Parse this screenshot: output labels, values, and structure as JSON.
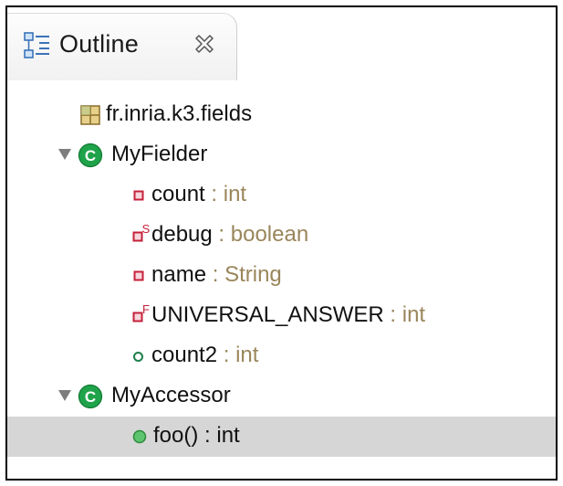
{
  "tab": {
    "title": "Outline",
    "icon": "outline-icon",
    "close_icon": "close-icon"
  },
  "tree": [
    {
      "id": "package",
      "name": "fr.inria.k3.fields",
      "type": "",
      "icon": "package-icon",
      "expanded": null
    },
    {
      "id": "class-myfielder",
      "name": "MyFielder",
      "type": "",
      "icon": "class-icon",
      "expanded": true
    },
    {
      "id": "field-count",
      "name": "count",
      "sep": " : ",
      "type": "int",
      "icon": "private-field-icon"
    },
    {
      "id": "field-debug",
      "name": "debug",
      "sep": " : ",
      "type": "boolean",
      "icon": "private-static-field-icon"
    },
    {
      "id": "field-name",
      "name": "name",
      "sep": " : ",
      "type": "String",
      "icon": "private-field-icon"
    },
    {
      "id": "field-universal",
      "name": "UNIVERSAL_ANSWER",
      "sep": " : ",
      "type": "int",
      "icon": "private-final-field-icon"
    },
    {
      "id": "field-count2",
      "name": "count2",
      "sep": " : ",
      "type": "int",
      "icon": "package-field-icon"
    },
    {
      "id": "class-myaccessor",
      "name": "MyAccessor",
      "type": "",
      "icon": "class-icon",
      "expanded": true
    },
    {
      "id": "method-foo",
      "name": "foo()",
      "sep": " : ",
      "type": "int",
      "icon": "public-method-icon",
      "selected": true
    }
  ],
  "colors": {
    "type_text": "#9a865b",
    "class_icon": "#1fa34a",
    "private_member": "#c6203b",
    "selection": "#d6d6d6"
  }
}
